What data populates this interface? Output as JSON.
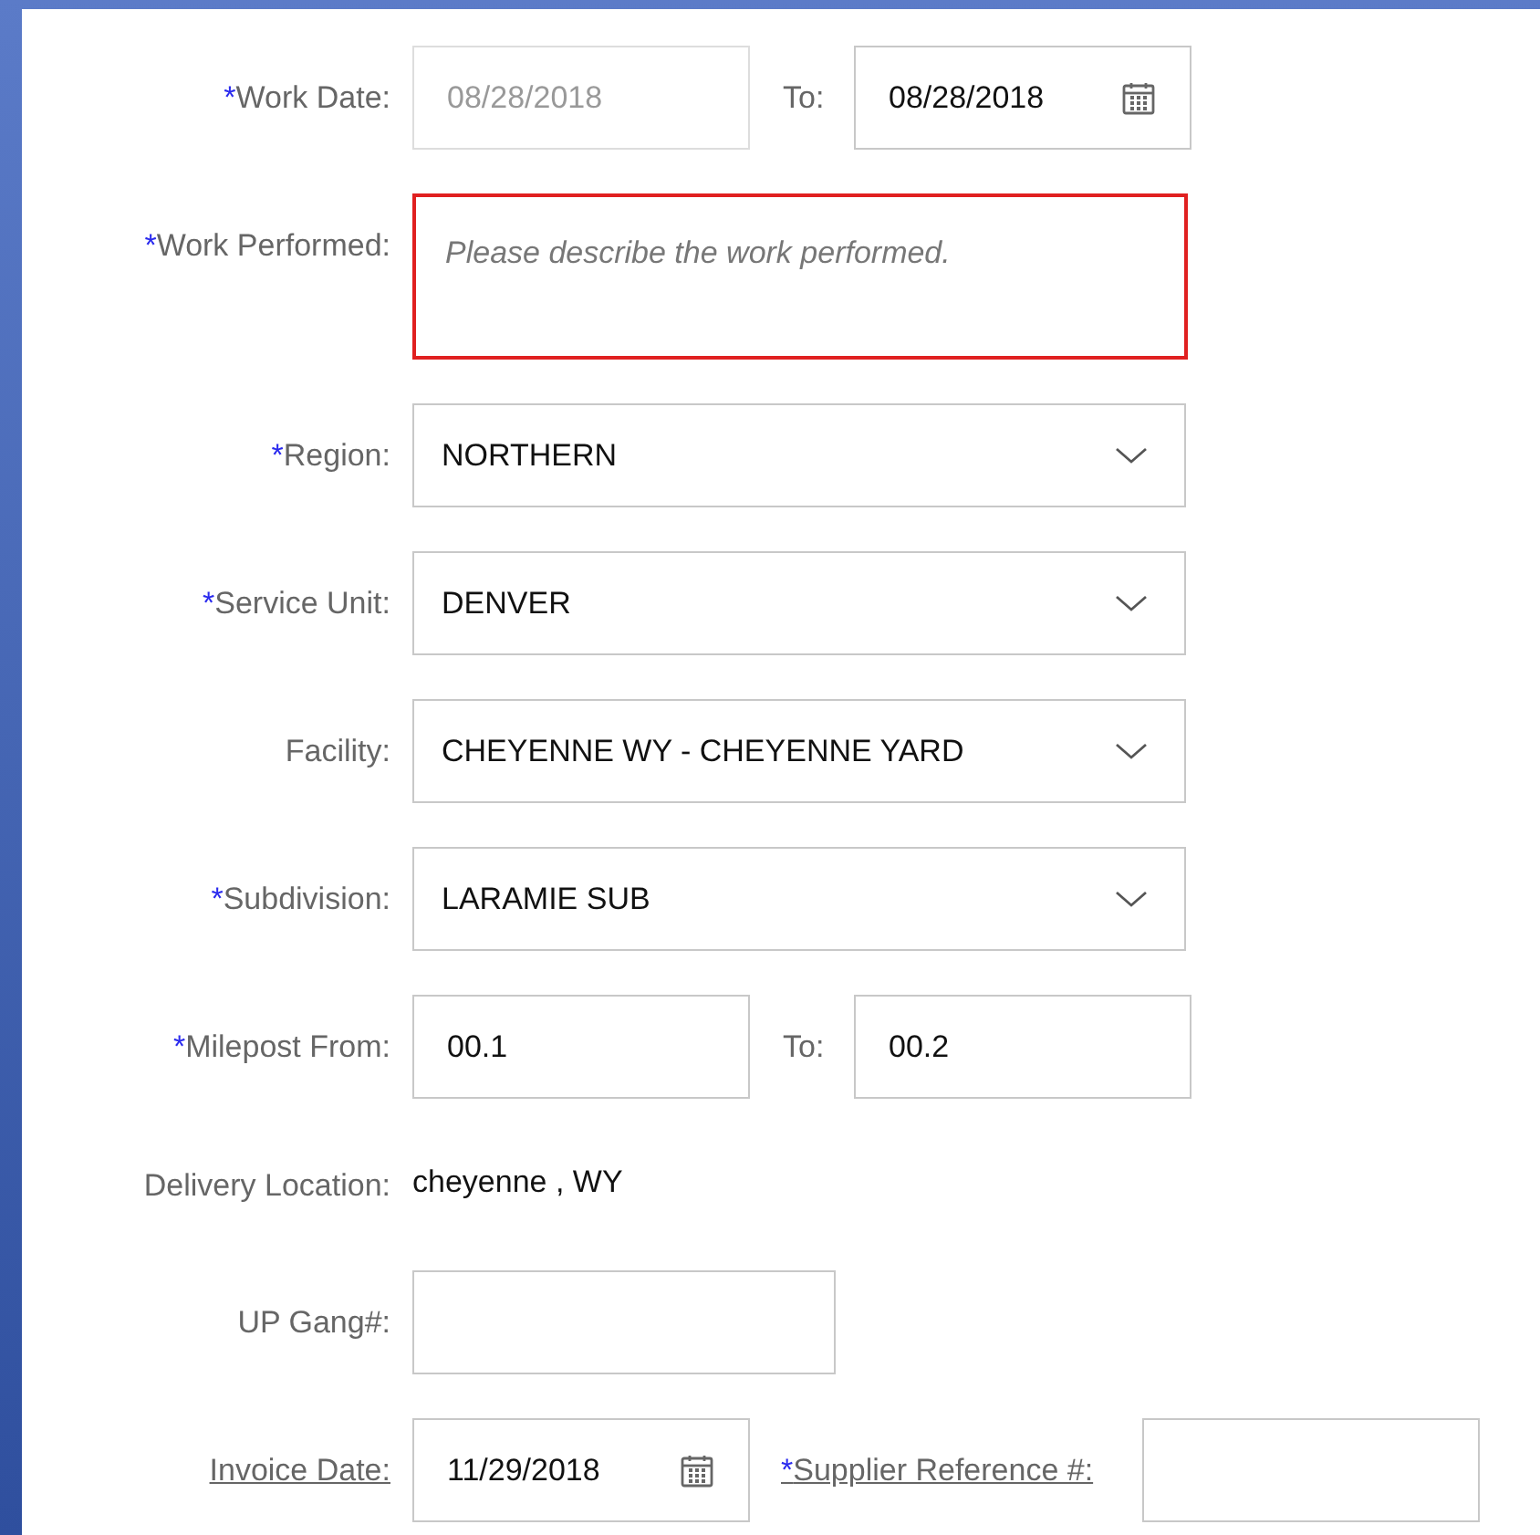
{
  "rows": [
    {
      "kind": "date_range",
      "mark": "*",
      "label": "Work Date:",
      "from": {
        "value": "08/28/2018",
        "disabled": true,
        "calendar": false
      },
      "to_label": "To:",
      "to": {
        "value": "08/28/2018",
        "disabled": false,
        "calendar": true
      }
    },
    {
      "kind": "textarea",
      "mark": "*",
      "label": "Work Performed:",
      "placeholder": "Please describe the work performed.",
      "error": true
    },
    {
      "kind": "select",
      "mark": "*",
      "label": "Region:",
      "value": "NORTHERN"
    },
    {
      "kind": "select",
      "mark": "*",
      "label": "Service Unit:",
      "value": "DENVER"
    },
    {
      "kind": "select",
      "label": "Facility:",
      "value": "CHEYENNE WY - CHEYENNE YARD"
    },
    {
      "kind": "select",
      "mark": "*",
      "label": "Subdivision:",
      "value": "LARAMIE SUB"
    },
    {
      "kind": "range",
      "mark": "*",
      "label": "Milepost From:",
      "from": "00.1",
      "to_label": "To:",
      "to": "00.2"
    },
    {
      "kind": "static",
      "label": "Delivery Location:",
      "value": "cheyenne , WY"
    },
    {
      "kind": "input",
      "label": "UP Gang#:"
    },
    {
      "kind": "invoice",
      "label": "Invoice Date:",
      "link": true,
      "value": "11/29/2018",
      "ref_mark": "*",
      "ref_label": "Supplier Reference #:",
      "ref_link": true
    }
  ]
}
